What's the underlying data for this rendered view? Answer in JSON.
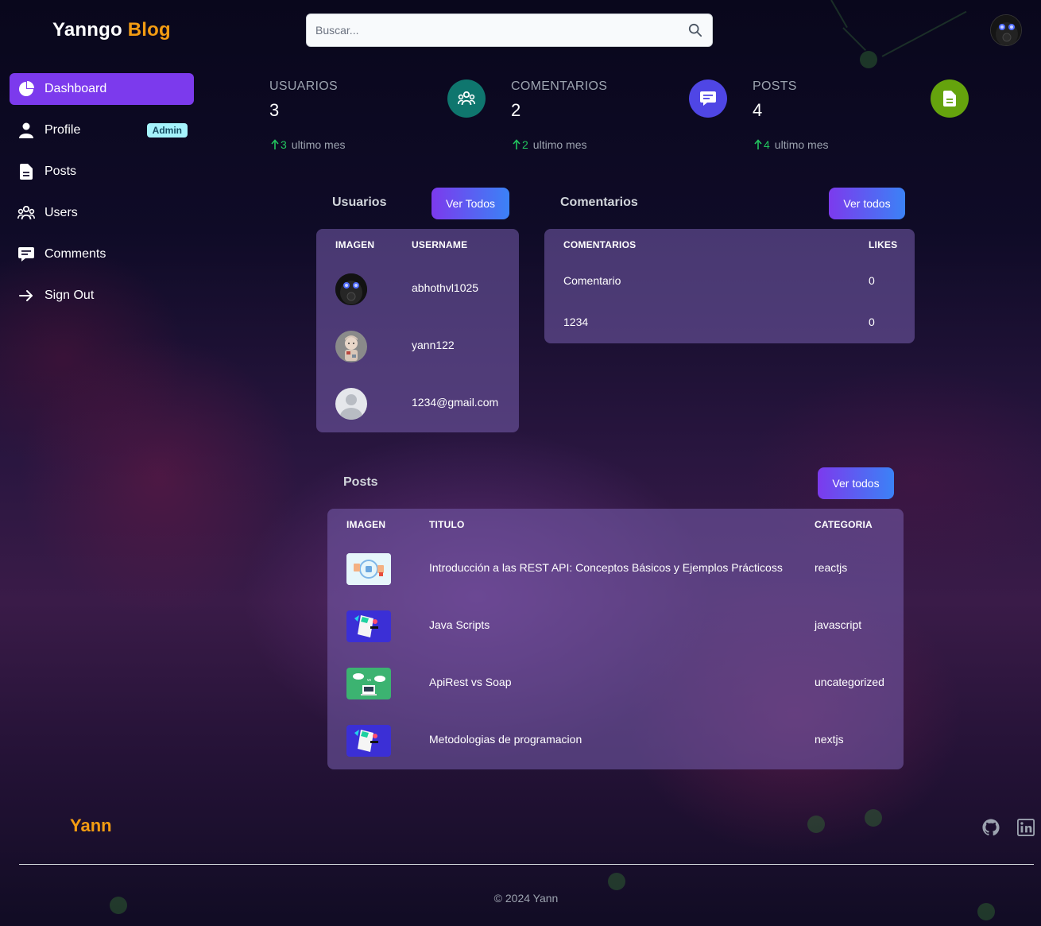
{
  "header": {
    "logo_part1": "Yanngo",
    "logo_part2": "Blog",
    "search_placeholder": "Buscar..."
  },
  "sidebar": {
    "items": [
      {
        "label": "Dashboard",
        "icon": "pie-chart-icon",
        "active": true
      },
      {
        "label": "Profile",
        "icon": "user-icon",
        "badge": "Admin"
      },
      {
        "label": "Posts",
        "icon": "document-icon"
      },
      {
        "label": "Users",
        "icon": "users-icon"
      },
      {
        "label": "Comments",
        "icon": "comment-icon"
      },
      {
        "label": "Sign Out",
        "icon": "arrow-right-icon"
      }
    ]
  },
  "stats": [
    {
      "label": "USUARIOS",
      "value": "3",
      "delta": "3",
      "period": "ultimo mes",
      "icon": "users-icon",
      "color": "#0f766e"
    },
    {
      "label": "COMENTARIOS",
      "value": "2",
      "delta": "2",
      "period": "ultimo mes",
      "icon": "comment-icon",
      "color": "#4f46e5"
    },
    {
      "label": "POSTS",
      "value": "4",
      "delta": "4",
      "period": "ultimo mes",
      "icon": "document-icon",
      "color": "#65a30d"
    }
  ],
  "users_section": {
    "title": "Usuarios",
    "button": "Ver Todos",
    "headers": [
      "IMAGEN",
      "USERNAME"
    ],
    "rows": [
      {
        "username": "abhothvl1025",
        "avatar": "gasmask-avatar-icon"
      },
      {
        "username": "yann122",
        "avatar": "cartoon-avatar-icon"
      },
      {
        "username": "1234@gmail.com",
        "avatar": "default-avatar-icon"
      }
    ]
  },
  "comments_section": {
    "title": "Comentarios",
    "button": "Ver todos",
    "headers": [
      "COMENTARIOS",
      "LIKES"
    ],
    "rows": [
      {
        "comment": "Comentario",
        "likes": "0"
      },
      {
        "comment": "1234",
        "likes": "0"
      }
    ]
  },
  "posts_section": {
    "title": "Posts",
    "button": "Ver todos",
    "headers": [
      "IMAGEN",
      "TITULO",
      "CATEGORIA"
    ],
    "rows": [
      {
        "title": "Introducción a las REST API: Conceptos Básicos y Ejemplos Prácticoss",
        "category": "reactjs",
        "thumb": "rest-api-thumb"
      },
      {
        "title": "Java Scripts",
        "category": "javascript",
        "thumb": "js-thumb"
      },
      {
        "title": "ApiRest vs Soap",
        "category": "uncategorized",
        "thumb": "soap-rest-thumb"
      },
      {
        "title": "Metodologias de programacion",
        "category": "nextjs",
        "thumb": "js-thumb"
      }
    ]
  },
  "footer": {
    "brand": "Yann",
    "copyright": "© 2024 Yann",
    "icons": [
      "github-icon",
      "linkedin-icon"
    ]
  }
}
